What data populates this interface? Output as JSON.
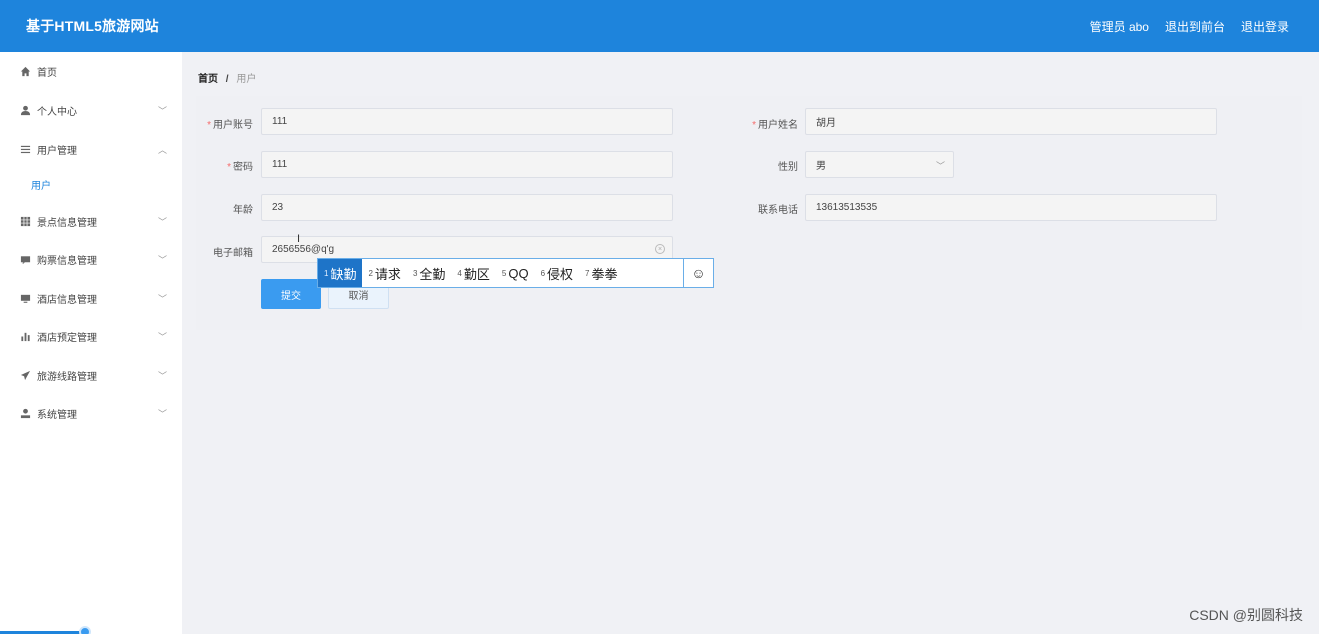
{
  "header": {
    "title": "基于HTML5旅游网站",
    "admin": "管理员 abo",
    "to_front": "退出到前台",
    "logout": "退出登录"
  },
  "sidebar": {
    "items": [
      {
        "label": "首页",
        "icon": "home-icon"
      },
      {
        "label": "个人中心",
        "icon": "user-icon"
      },
      {
        "label": "用户管理",
        "icon": "list-icon"
      },
      {
        "label": "用户",
        "icon": ""
      },
      {
        "label": "景点信息管理",
        "icon": "grid-icon"
      },
      {
        "label": "购票信息管理",
        "icon": "ticket-icon"
      },
      {
        "label": "酒店信息管理",
        "icon": "monitor-icon"
      },
      {
        "label": "酒店预定管理",
        "icon": "bar-chart-icon"
      },
      {
        "label": "旅游线路管理",
        "icon": "send-icon"
      },
      {
        "label": "系统管理",
        "icon": "user-icon"
      }
    ]
  },
  "breadcrumb": {
    "home": "首页",
    "sep": "/",
    "current": "用户"
  },
  "form": {
    "account": {
      "label": "用户账号",
      "value": "111",
      "required": true
    },
    "name": {
      "label": "用户姓名",
      "value": "胡月",
      "required": true
    },
    "password": {
      "label": "密码",
      "value": "111",
      "required": true
    },
    "gender": {
      "label": "性别",
      "value": "男"
    },
    "age": {
      "label": "年龄",
      "value": "23"
    },
    "phone": {
      "label": "联系电话",
      "value": "13613513535"
    },
    "email": {
      "label": "电子邮箱",
      "value": "2656556@q'g"
    },
    "submit": "提交",
    "cancel": "取消"
  },
  "ime": {
    "candidates": [
      {
        "n": "1",
        "text": "缺勤"
      },
      {
        "n": "2",
        "text": "请求"
      },
      {
        "n": "3",
        "text": "全勤"
      },
      {
        "n": "4",
        "text": "勤区"
      },
      {
        "n": "5",
        "text": "QQ"
      },
      {
        "n": "6",
        "text": "侵权"
      },
      {
        "n": "7",
        "text": "拳拳"
      }
    ],
    "emoji": "☺"
  },
  "text_cursor": "I",
  "watermark": "CSDN @别圆科技",
  "colors": {
    "primary": "#1e84dc",
    "button": "#3a9bf0",
    "required": "#f56c6c"
  }
}
